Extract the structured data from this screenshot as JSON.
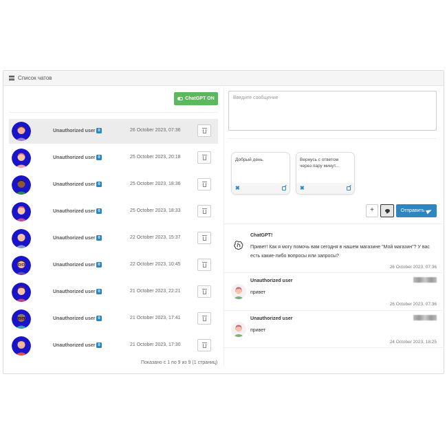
{
  "panel": {
    "title": "Список чатов"
  },
  "chatgpt_button": {
    "label": "ChatGPT ON"
  },
  "chats": [
    {
      "user": "Unauthorized user",
      "badge": "0",
      "date": "26 October 2023, 07:36",
      "active": true
    },
    {
      "user": "Unauthorized user",
      "badge": "0",
      "date": "25 October 2023, 20:18"
    },
    {
      "user": "Unauthorized user",
      "badge": "0",
      "date": "25 October 2023, 18:36"
    },
    {
      "user": "Unauthorized user",
      "badge": "0",
      "date": "25 October 2023, 18:33"
    },
    {
      "user": "Unauthorized user",
      "badge": "0",
      "date": "22 October 2023, 15:37"
    },
    {
      "user": "Unauthorized user",
      "badge": "0",
      "date": "22 October 2023, 10:45"
    },
    {
      "user": "Unauthorized user",
      "badge": "0",
      "date": "21 October 2023, 22:21"
    },
    {
      "user": "Unauthorized user",
      "badge": "0",
      "date": "21 October 2023, 17:41"
    },
    {
      "user": "Unauthorized user",
      "badge": "0",
      "date": "21 October 2023, 17:30"
    }
  ],
  "pagination": {
    "info": "Показано с 1 по 9 из 9 (1 страниц)"
  },
  "composer": {
    "placeholder": "Введите сообщение",
    "send_label": "Отправить",
    "add_label": "+"
  },
  "templates": [
    {
      "text": "Добрый день."
    },
    {
      "text": "Вернусь с ответом через пару минут..."
    }
  ],
  "messages": [
    {
      "author": "ChatGPT!",
      "text": "Привет! Как я могу помочь вам сегодня в нашем магазине \"Мой магазин\"? У вас есть какие-либо вопросы или запросы?",
      "time": "26 October 2023, 07:36",
      "icon": "openai-icon"
    },
    {
      "author": "Unauthorized user",
      "text": "привет",
      "time": "26 October 2023, 07:36",
      "icon": "user-avatar"
    },
    {
      "author": "Unauthorized user",
      "text": "привет",
      "time": "24 October 2023, 18:25",
      "icon": "user-avatar"
    }
  ],
  "colors": {
    "accent": "#2e86c1",
    "success": "#5cb85c",
    "avatar_bg": "#1a14c9"
  }
}
